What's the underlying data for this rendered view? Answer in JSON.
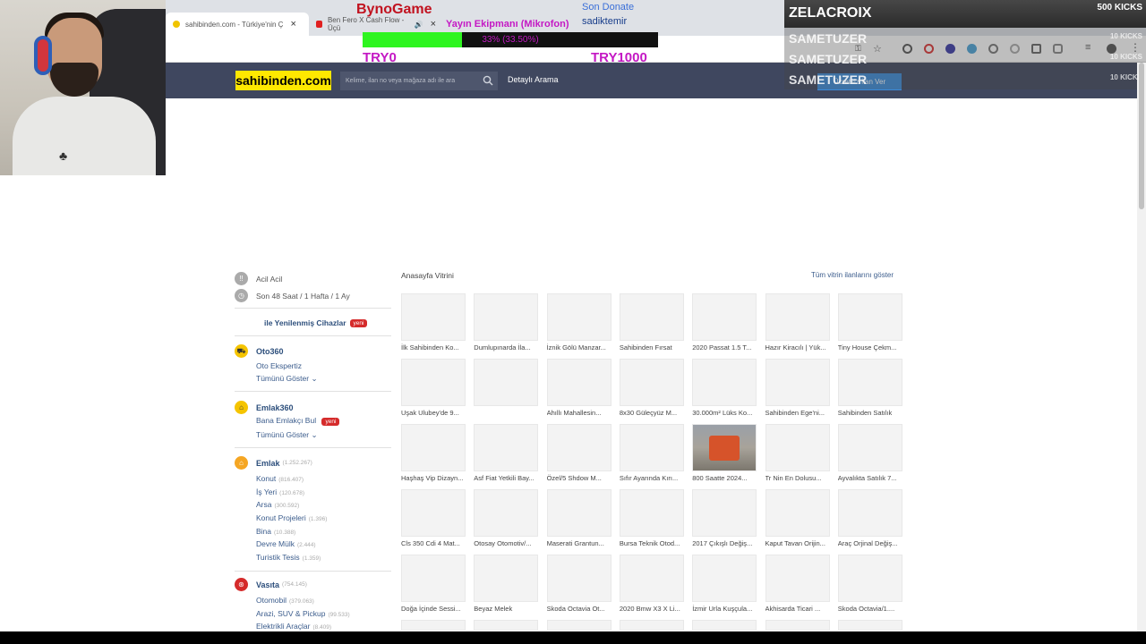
{
  "browser": {
    "tabs": [
      {
        "label": "sahibinden.com - Türkiye'nin Ç",
        "active": true
      },
      {
        "label": "Ben Fero X Cash Flow - Üçü",
        "active": false
      }
    ]
  },
  "header": {
    "logo": "sahibinden.com",
    "search_placeholder": "Kelime, ilan no veya mağaza adı ile ara",
    "detailed_search": "Detaylı Arama",
    "post_listing": "Ücretsiz İlan Ver"
  },
  "overlay": {
    "donate_brand": "BynoGame",
    "goal_title": "Yayın Ekipmanı (Mikrofon)",
    "goal_text": "33% (33.50%)",
    "goal_fraction": 0.335,
    "goal_min": "TRY0",
    "goal_max": "TRY1000",
    "last_donate_label": "Son Donate",
    "last_donate_name": "sadiktemir",
    "kicks": [
      {
        "name": "ZELACROIX",
        "amount": "500 KICKS"
      },
      {
        "name": "SAMETUZER",
        "amount": "10 KICKS"
      },
      {
        "name": "SAMETUZER",
        "amount": "10 KICKS"
      },
      {
        "name": "SAMETUZER",
        "amount": "10 KICKS"
      }
    ]
  },
  "sidebar": {
    "urgent": "Acil Acil",
    "recent": "Son 48 Saat / 1 Hafta / 1 Ay",
    "refurbished": "ile Yenilenmiş Cihazlar",
    "new_badge": "yeni",
    "oto360": {
      "title": "Oto360",
      "links": [
        "Oto Ekspertiz",
        "Tümünü Göster"
      ]
    },
    "emlak360": {
      "title": "Emlak360",
      "links": [
        "Bana Emlakçı Bul",
        "Tümünü Göster"
      ]
    },
    "emlak": {
      "title": "Emlak",
      "count": "(1.252.267)",
      "items": [
        {
          "label": "Konut",
          "count": "(816.407)"
        },
        {
          "label": "İş Yeri",
          "count": "(120.678)"
        },
        {
          "label": "Arsa",
          "count": "(300.592)"
        },
        {
          "label": "Konut Projeleri",
          "count": "(1.396)"
        },
        {
          "label": "Bina",
          "count": "(10.388)"
        },
        {
          "label": "Devre Mülk",
          "count": "(2.444)"
        },
        {
          "label": "Turistik Tesis",
          "count": "(1.359)"
        }
      ]
    },
    "vasita": {
      "title": "Vasıta",
      "count": "(754.145)",
      "items": [
        {
          "label": "Otomobil",
          "count": "(379.063)"
        },
        {
          "label": "Arazi, SUV & Pickup",
          "count": "(99.533)"
        },
        {
          "label": "Elektrikli Araçlar",
          "count": "(8.409)"
        }
      ]
    }
  },
  "showcase": {
    "title": "Anasayfa Vitrini",
    "view_all": "Tüm vitrin ilanlarını göster",
    "items": [
      "İlk Sahibinden Ko...",
      "Dumlupınarda İla...",
      "İznik Gölü Manzar...",
      "Sahibinden Fırsat",
      "2020 Passat 1.5 T...",
      "Hazır Kiracılı | Yük...",
      "Tiny House Çekm...",
      "Uşak Ulubey'de 9...",
      "",
      "Ahıllı Mahallesin...",
      "8x30 Güleçyüz M...",
      "30.000m² Lüks Ko...",
      "Sahibinden Ege'ni...",
      "Sahibinden Satılık",
      "Haşhaş Vip Dizayn...",
      "Asf Fiat Yetkili Bay...",
      "Özel/5 Shdow M...",
      "Sıfır Ayarında Kırı...",
      "800 Saatte 2024...",
      "Tr Nin En Dolusu...",
      "Ayvalıkta Satılık 7...",
      "Cls 350 Cdi 4 Mat...",
      "Otosay Otomotiv/...",
      "Maserati Grantun...",
      "Bursa Teknik Otod...",
      "2017 Çıkışlı Değiş...",
      "Kaput Tavan Orijin...",
      "Araç Orjinal Değiş...",
      "Doğa İçinde Sessi...",
      "Beyaz Melek",
      "Skoda Octavia Ot...",
      "2020 Bmw X3 X Li...",
      "İzmir Urla Kuşçula...",
      "Akhisarda Ticari ...",
      "Skoda Octavia/1...."
    ]
  },
  "colors": {
    "header_bg": "#3f475f",
    "logo_bg": "#ffe800",
    "link": "#3b5c8c",
    "badge": "#d52b2b",
    "goal_fill": "#2ef520",
    "goal_text": "#c418c4"
  }
}
